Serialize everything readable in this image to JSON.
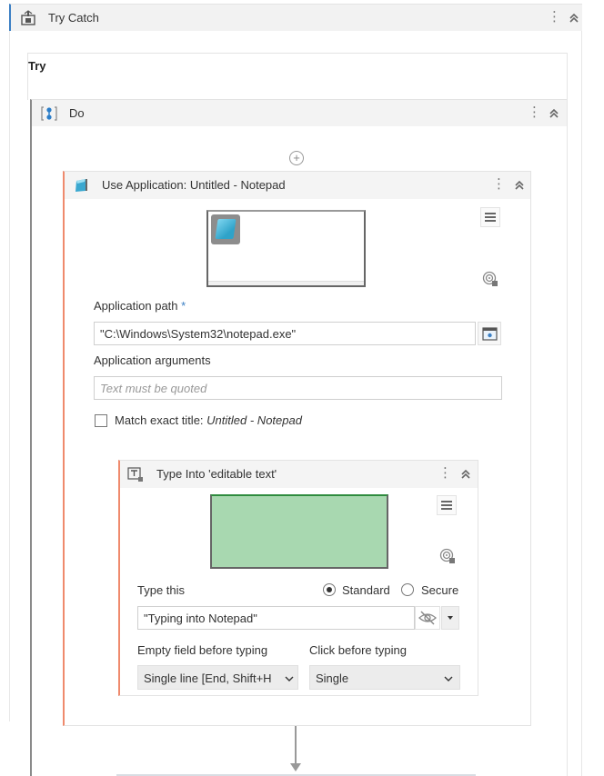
{
  "try_catch": {
    "title": "Try Catch",
    "icon": "try-catch-icon",
    "more_icon": "kebab-icon",
    "collapse_icon": "double-chevron-up-icon"
  },
  "try_section": {
    "label": "Try"
  },
  "do_sequence": {
    "title": "Do",
    "icon": "sequence-icon"
  },
  "use_application": {
    "title": "Use Application: Untitled - Notepad",
    "icon": "notepad-app-icon",
    "fields": {
      "application_path": {
        "label": "Application path",
        "required_marker": "*",
        "value": "\"C:\\Windows\\System32\\notepad.exe\""
      },
      "application_arguments": {
        "label": "Application arguments",
        "value": "",
        "placeholder": "Text must be quoted"
      },
      "match_exact_title": {
        "label": "Match exact title:",
        "title_value": "Untitled - Notepad",
        "checked": false
      }
    }
  },
  "type_into": {
    "title": "Type Into 'editable text'",
    "icon": "type-into-icon",
    "type_this": {
      "label": "Type this",
      "value": "\"Typing into Notepad\"",
      "mode_options": [
        {
          "label": "Standard",
          "selected": true
        },
        {
          "label": "Secure",
          "selected": false
        }
      ]
    },
    "empty_field": {
      "label": "Empty field before typing",
      "selected": "Single line [End, Shift+H"
    },
    "click_before": {
      "label": "Click before typing",
      "selected": "Single"
    }
  },
  "colors": {
    "accent_blue": "#3b7fc4",
    "activity_accent": "#ef8a6d",
    "highlight_green": "#a8d8b0"
  }
}
